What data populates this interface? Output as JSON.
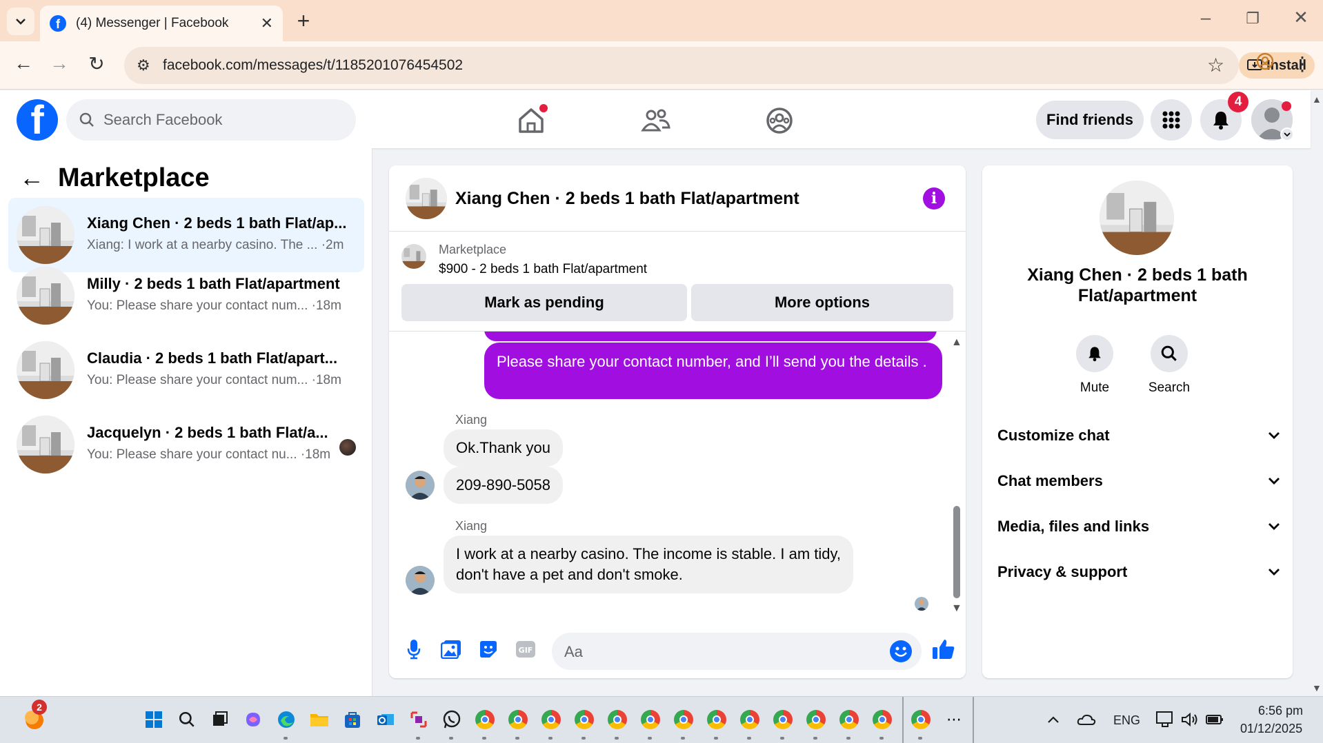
{
  "browser": {
    "tab_title": "(4) Messenger | Facebook",
    "url": "facebook.com/messages/t/1185201076454502",
    "install_label": "Install"
  },
  "fb": {
    "search_placeholder": "Search Facebook",
    "find_friends_label": "Find friends",
    "notification_count": "4"
  },
  "sidebar": {
    "title": "Marketplace",
    "conversations": [
      {
        "name": "Xiang Chen · 2 beds 1 bath Flat/ap...",
        "snippet": "Xiang: I work at a nearby casino. The ... ·2m",
        "active": true
      },
      {
        "name": "Milly · 2 beds 1 bath Flat/apartment",
        "snippet": "You: Please share your contact num... ·18m",
        "active": false
      },
      {
        "name": "Claudia · 2 beds 1 bath Flat/apart...",
        "snippet": "You: Please share your contact num... ·18m",
        "active": false
      },
      {
        "name": "Jacquelyn · 2 beds 1 bath Flat/a...",
        "snippet": "You: Please share your contact nu... ·18m",
        "active": false
      }
    ]
  },
  "chat": {
    "title": "Xiang Chen · 2 beds 1 bath Flat/apartment",
    "marketplace_label": "Marketplace",
    "listing": "$900 - 2 beds 1 bath Flat/apartment",
    "mark_pending_label": "Mark as pending",
    "more_options_label": "More options",
    "messages": {
      "outgoing_1": "Please share your contact number, and I’ll send you the details .",
      "sender_1": "Xiang",
      "incoming_1": "Ok.Thank you",
      "incoming_2": "209-890-5058",
      "sender_2": "Xiang",
      "incoming_3_line1": "I work at a nearby casino. The income is stable. I am tidy,",
      "incoming_3_line2": "don't have a pet and don't smoke."
    },
    "composer_placeholder": "Aa"
  },
  "info_panel": {
    "name": "Xiang Chen · 2 beds 1 bath Flat/apartment",
    "mute_label": "Mute",
    "search_label": "Search",
    "sections": [
      "Customize chat",
      "Chat members",
      "Media, files and links",
      "Privacy & support"
    ]
  },
  "taskbar": {
    "badge_count": "2",
    "language": "ENG",
    "time": "6:56 pm",
    "date": "01/12/2025"
  },
  "colors": {
    "fb_blue": "#0866ff",
    "outgoing_bubble": "#a10ee0",
    "badge_red": "#e41e3f",
    "active_conversation": "#ebf5ff"
  }
}
